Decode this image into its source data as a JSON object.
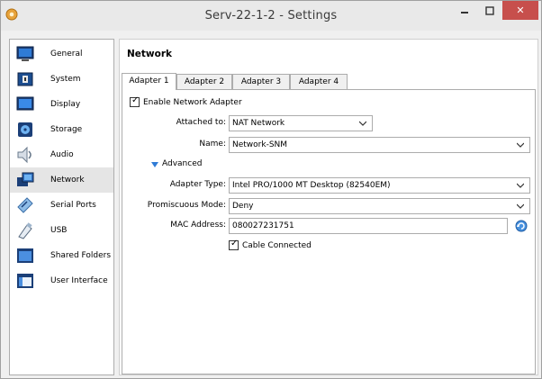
{
  "window": {
    "title": "Serv-22-1-2 - Settings",
    "close_glyph": "✕"
  },
  "sidebar": {
    "items": [
      {
        "label": "General",
        "icon": "monitor-icon"
      },
      {
        "label": "System",
        "icon": "chip-icon"
      },
      {
        "label": "Display",
        "icon": "display-icon"
      },
      {
        "label": "Storage",
        "icon": "disk-icon"
      },
      {
        "label": "Audio",
        "icon": "speaker-icon"
      },
      {
        "label": "Network",
        "icon": "network-icon",
        "selected": true
      },
      {
        "label": "Serial Ports",
        "icon": "serial-icon"
      },
      {
        "label": "USB",
        "icon": "usb-icon"
      },
      {
        "label": "Shared Folders",
        "icon": "folder-icon"
      },
      {
        "label": "User Interface",
        "icon": "window-icon"
      }
    ]
  },
  "page": {
    "title": "Network"
  },
  "tabs": [
    {
      "label": "Adapter 1",
      "active": true
    },
    {
      "label": "Adapter 2"
    },
    {
      "label": "Adapter 3"
    },
    {
      "label": "Adapter 4"
    }
  ],
  "adapter": {
    "enable_label": "Enable Network Adapter",
    "enable_checked": true,
    "attached_label": "Attached to:",
    "attached_value": "NAT Network",
    "name_label": "Name:",
    "name_value": "Network-SNM",
    "advanced_label": "Advanced",
    "adapter_type_label": "Adapter Type:",
    "adapter_type_value": "Intel PRO/1000 MT Desktop (82540EM)",
    "promiscuous_label": "Promiscuous Mode:",
    "promiscuous_value": "Deny",
    "mac_label": "MAC Address:",
    "mac_value": "080027231751",
    "cable_label": "Cable Connected",
    "cable_checked": true
  },
  "colors": {
    "close": "#c74f4c",
    "selected": "#e5e5e5",
    "accent": "#2f7bd6"
  }
}
